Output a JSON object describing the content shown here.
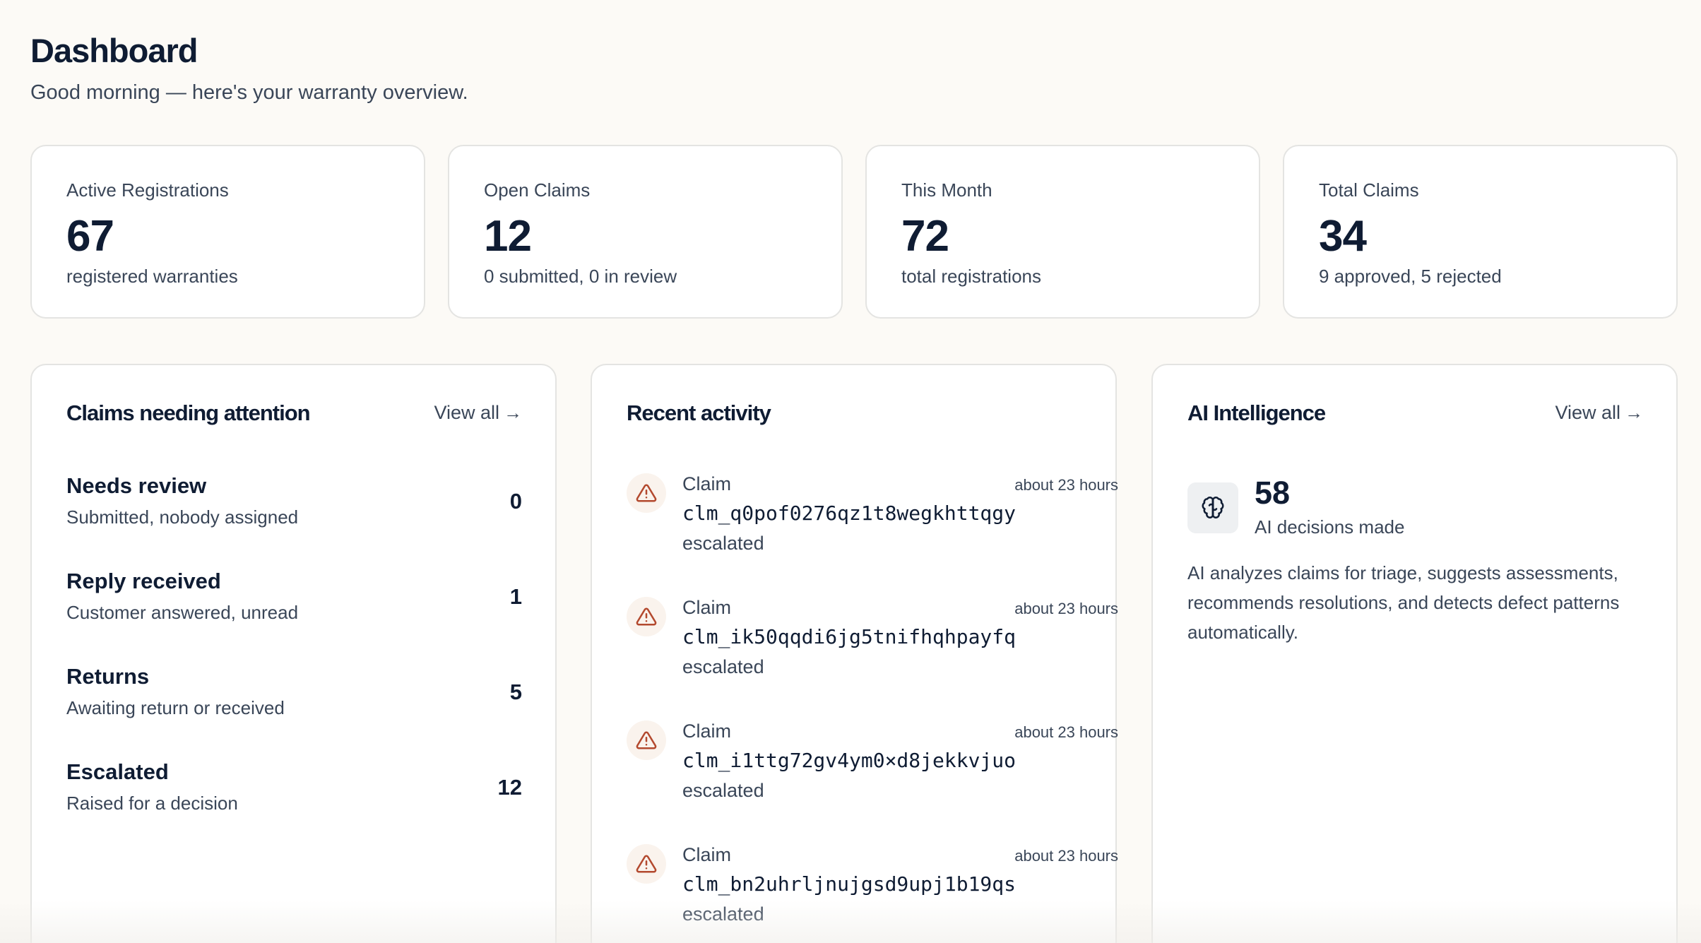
{
  "header": {
    "title": "Dashboard",
    "subtitle": "Good morning — here's your warranty overview."
  },
  "stats": [
    {
      "label": "Active Registrations",
      "value": "67",
      "caption": "registered warranties"
    },
    {
      "label": "Open Claims",
      "value": "12",
      "caption": "0 submitted, 0 in review"
    },
    {
      "label": "This Month",
      "value": "72",
      "caption": "total registrations"
    },
    {
      "label": "Total Claims",
      "value": "34",
      "caption": "9 approved, 5 rejected"
    }
  ],
  "attention": {
    "title": "Claims needing attention",
    "view_all": "View all",
    "items": [
      {
        "title": "Needs review",
        "desc": "Submitted, nobody assigned",
        "count": "0"
      },
      {
        "title": "Reply received",
        "desc": "Customer answered, unread",
        "count": "1"
      },
      {
        "title": "Returns",
        "desc": "Awaiting return or received",
        "count": "5"
      },
      {
        "title": "Escalated",
        "desc": "Raised for a decision",
        "count": "12"
      }
    ]
  },
  "activity": {
    "title": "Recent activity",
    "items": [
      {
        "kind": "Claim",
        "id": "clm_q0pof0276qz1t8wegkhttqgy",
        "status": "escalated",
        "time": "about 23 hours"
      },
      {
        "kind": "Claim",
        "id": "clm_ik50qqdi6jg5tnifhqhpayfq",
        "status": "escalated",
        "time": "about 23 hours"
      },
      {
        "kind": "Claim",
        "id": "clm_i1ttg72gv4ym0×d8jekkvjuo",
        "status": "escalated",
        "time": "about 23 hours"
      },
      {
        "kind": "Claim",
        "id": "clm_bn2uhrljnujgsd9upj1b19qs",
        "status": "escalated",
        "time": "about 23 hours"
      }
    ]
  },
  "ai": {
    "title": "AI Intelligence",
    "view_all": "View all",
    "count": "58",
    "count_label": "AI decisions made",
    "description": "AI analyzes claims for triage, suggests assessments, recommends resolutions, and detects defect patterns automatically."
  },
  "icons": {
    "activity": "warning-triangle-icon",
    "ai": "brain-icon",
    "view_all": "arrow-right-icon"
  },
  "colors": {
    "background": "#fcfaf6",
    "card": "#ffffff",
    "text_primary": "#0f1c33",
    "text_secondary": "#3a4658",
    "warning": "#b3492e"
  }
}
